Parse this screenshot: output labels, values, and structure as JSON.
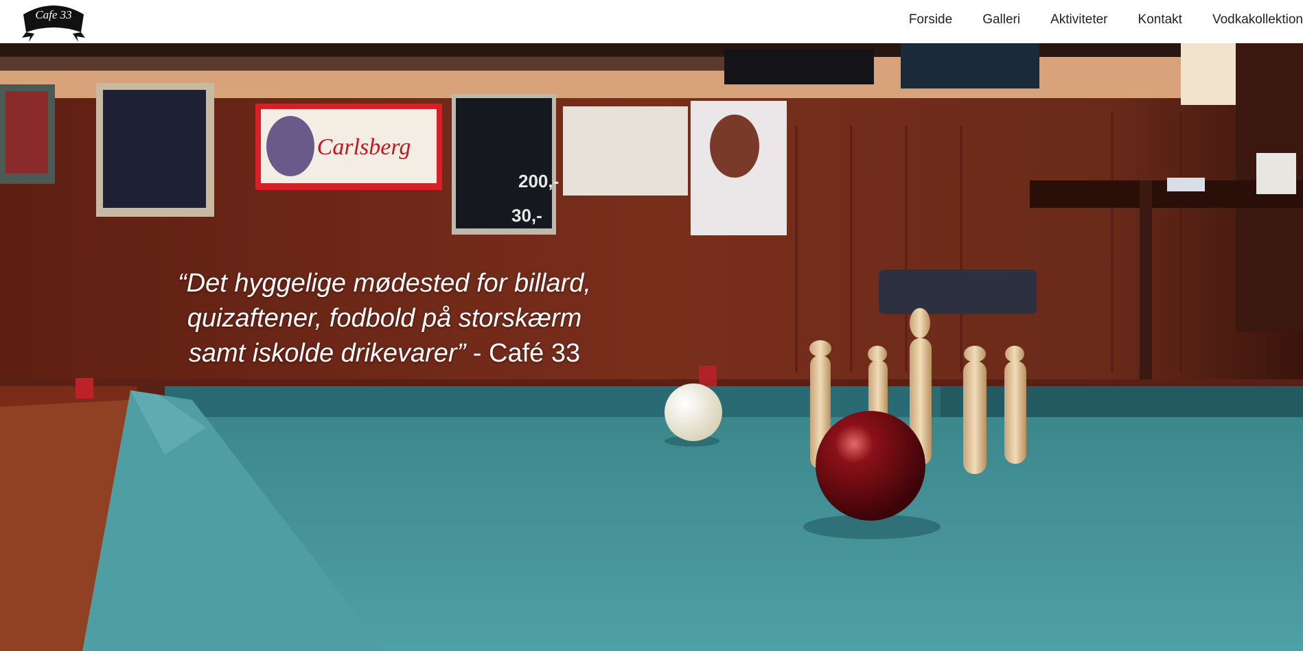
{
  "logo": {
    "text": "Cafe 33"
  },
  "nav": {
    "items": [
      {
        "label": "Forside"
      },
      {
        "label": "Galleri"
      },
      {
        "label": "Aktiviteter"
      },
      {
        "label": "Kontakt"
      },
      {
        "label": "Vodkakollektion"
      }
    ]
  },
  "hero": {
    "quote_line1": "“Det hyggelige mødested for billard,",
    "quote_line2": "quizaftener, fodbold på storskærm",
    "quote_line3_italic": "samt iskolde drikevarer”",
    "quote_attribution": " - Café 33",
    "poster_price_1": "200,-",
    "poster_price_2": "30,-"
  },
  "colors": {
    "header_bg": "#ffffff",
    "nav_text": "#222222",
    "wall": "#6b2a1a",
    "felt": "#3f8f94",
    "quote_text": "#ffffff"
  }
}
